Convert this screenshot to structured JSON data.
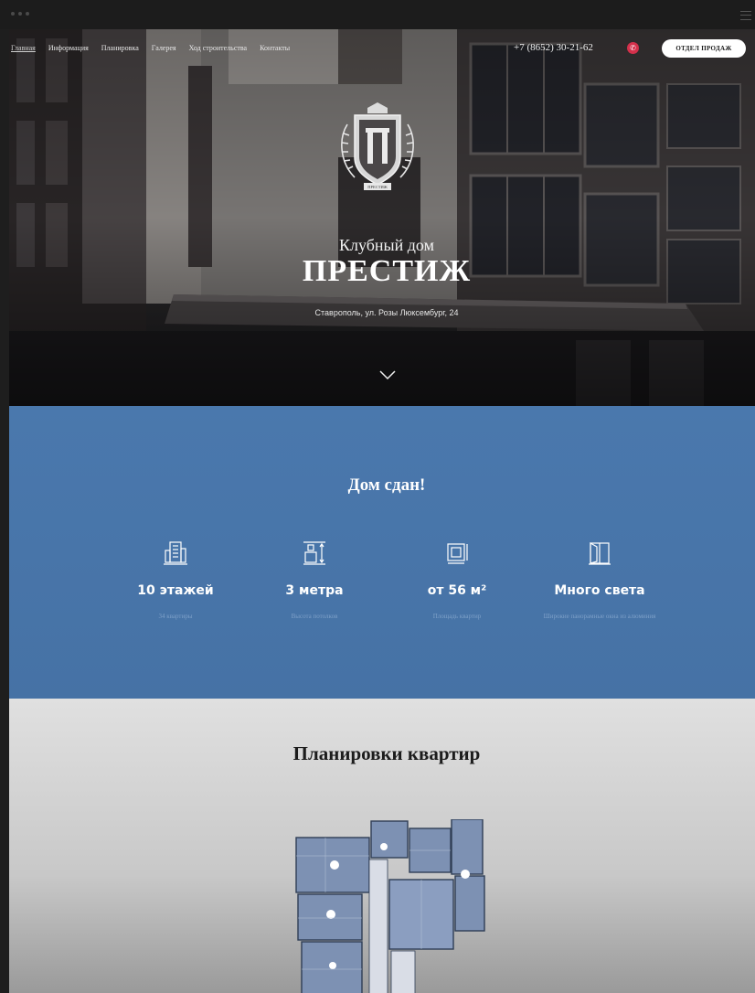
{
  "nav": {
    "items": [
      "Главная",
      "Информация",
      "Планировка",
      "Галерея",
      "Ход строительства",
      "Контакты"
    ],
    "active_index": 0
  },
  "header": {
    "phone": "+7 (8652) 30-21-62",
    "sales_button": "ОТДЕЛ ПРОДАЖ"
  },
  "hero": {
    "logo_text": "ПРЕСТИЖ",
    "subtitle": "Клубный дом",
    "title": "ПРЕСТИЖ",
    "address": "Ставрополь, ул. Розы Люксембург, 24"
  },
  "status": {
    "title": "Дом сдан!",
    "features": [
      {
        "icon": "building-icon",
        "value": "10 этажей",
        "desc": "34 квартиры"
      },
      {
        "icon": "ceiling-height-icon",
        "value": "3 метра",
        "desc": "Высота потолков"
      },
      {
        "icon": "floor-area-icon",
        "value": "от 56 м²",
        "desc": "Площадь квартир"
      },
      {
        "icon": "window-icon",
        "value": "Много света",
        "desc": "Широкие панорамные окна из алюминия"
      }
    ]
  },
  "plans": {
    "title": "Планировки квартир"
  },
  "colors": {
    "blue_section": "#4a78ad",
    "accent_red": "#d3304b"
  }
}
